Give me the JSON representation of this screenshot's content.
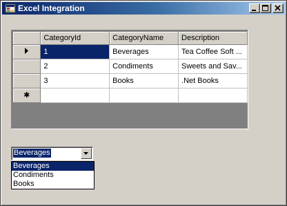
{
  "window": {
    "title": "Excel Integration",
    "icon": "form-app-icon"
  },
  "grid": {
    "columns": [
      "CategoryId",
      "CategoryName",
      "Description"
    ],
    "rows": [
      {
        "id": "1",
        "name": "Beverages",
        "description": "Tea Coffee Soft ..."
      },
      {
        "id": "2",
        "name": "Condiments",
        "description": "Sweets and Sav..."
      },
      {
        "id": "3",
        "name": "Books",
        "description": ".Net Books"
      }
    ],
    "current_row_indicator": "▶",
    "new_row_indicator": "✱"
  },
  "combo": {
    "selected": "Beverages",
    "options": [
      "Beverages",
      "Condiments",
      "Books"
    ]
  },
  "colors": {
    "selection": "#0a246a",
    "face": "#d4d0c8",
    "grid_background": "#808080"
  }
}
